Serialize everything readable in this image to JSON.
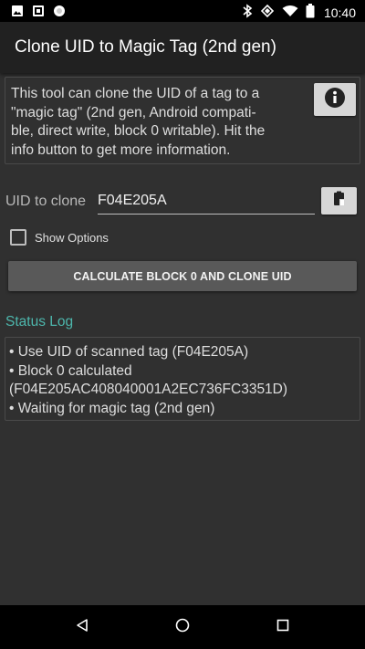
{
  "status_bar": {
    "time": "10:40",
    "left_icons": [
      "image-icon",
      "photos-icon",
      "circle-notification-icon"
    ],
    "right_icons": [
      "bluetooth-icon",
      "nfc-icon",
      "wifi-icon",
      "battery-icon"
    ]
  },
  "app_bar": {
    "title": "Clone UID to Magic Tag (2nd gen)"
  },
  "info": {
    "text_lines": [
      "This tool can clone the UID of a tag to a",
      "\"magic tag\" (2nd gen, Android compati-",
      "ble, direct write, block 0 writable). Hit the",
      "info button to get more information."
    ],
    "button_icon": "info-icon"
  },
  "uid": {
    "label": "UID to clone",
    "value": "F04E205A",
    "paste_icon": "paste-icon"
  },
  "options": {
    "show_options_label": "Show Options",
    "checked": false
  },
  "actions": {
    "calculate_label": "CALCULATE BLOCK 0 AND CLONE UID"
  },
  "status_log": {
    "title": "Status Log",
    "lines": [
      "• Use UID of scanned tag (F04E205A)",
      "• Block 0 calculated",
      "(F04E205AC408040001A2EC736FC3351D)",
      "• Waiting for magic tag (2nd gen)"
    ]
  },
  "colors": {
    "background": "#303030",
    "app_bar": "#212121",
    "accent": "#4db6ac",
    "button": "#595959"
  },
  "nav_bar": {
    "icons": [
      "back-icon",
      "home-icon",
      "recents-icon"
    ]
  }
}
